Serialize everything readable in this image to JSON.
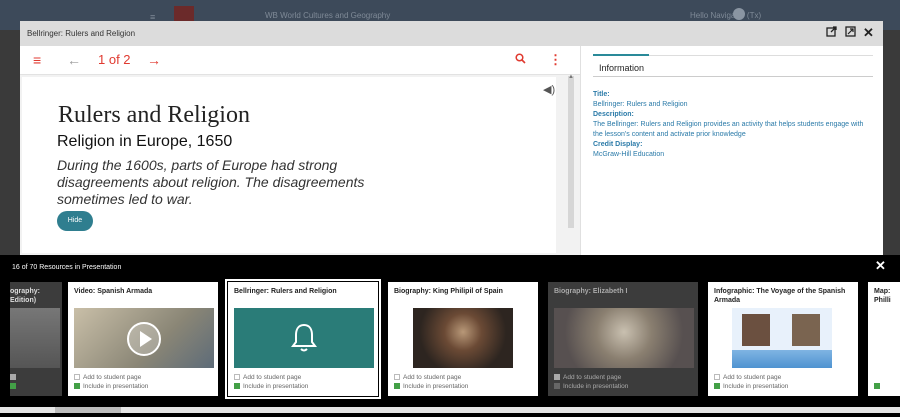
{
  "background_app": {
    "menu_glyph": "≡",
    "title": "WB World Cultures and Geography",
    "user": "Hello Navigator (Tx)"
  },
  "modal": {
    "title": "Bellringer: Rulers and Religion",
    "icons": [
      "external-link-icon",
      "expand-icon",
      "close-icon"
    ]
  },
  "viewer": {
    "page_indicator": "1 of 2",
    "heading": "Rulers and Religion",
    "subheading": "Religion in Europe, 1650",
    "body": "During the 1600s, parts of Europe had strong disagreements about religion. The disagreements sometimes led to war.",
    "hide_label": "Hide"
  },
  "info_panel": {
    "tab_label": "Information",
    "title_key": "Title:",
    "title_value": "Bellringer: Rulers and Religion",
    "description_key": "Description:",
    "description_value": "The Bellringer: Rulers and Religion provides an activity that helps students engage with the lesson's content and activate prior knowledge",
    "credit_key": "Credit Display:",
    "credit_value": "McGraw-Hill Education"
  },
  "strip": {
    "count_label": "16 of 70 Resources in Presentation",
    "add_label": "Add to student page",
    "include_label": "Include in presentation",
    "cards": [
      {
        "title": "ography: Edition)",
        "add": false,
        "include": true
      },
      {
        "title": "Video: Spanish Armada",
        "add": false,
        "include": true
      },
      {
        "title": "Bellringer: Rulers and Religion",
        "add": false,
        "include": true
      },
      {
        "title": "Biography: King Philipil of Spain",
        "add": false,
        "include": true
      },
      {
        "title": "Biography: Elizabeth I",
        "add": true,
        "include": false
      },
      {
        "title": "Infographic: The Voyage of the Spanish Armada",
        "add": false,
        "include": true
      },
      {
        "title": "Map: Philli",
        "add": false,
        "include": true
      }
    ]
  },
  "colors": {
    "accent_red": "#e03a30",
    "teal": "#2a7c78",
    "link_blue": "#2a7aa8"
  }
}
